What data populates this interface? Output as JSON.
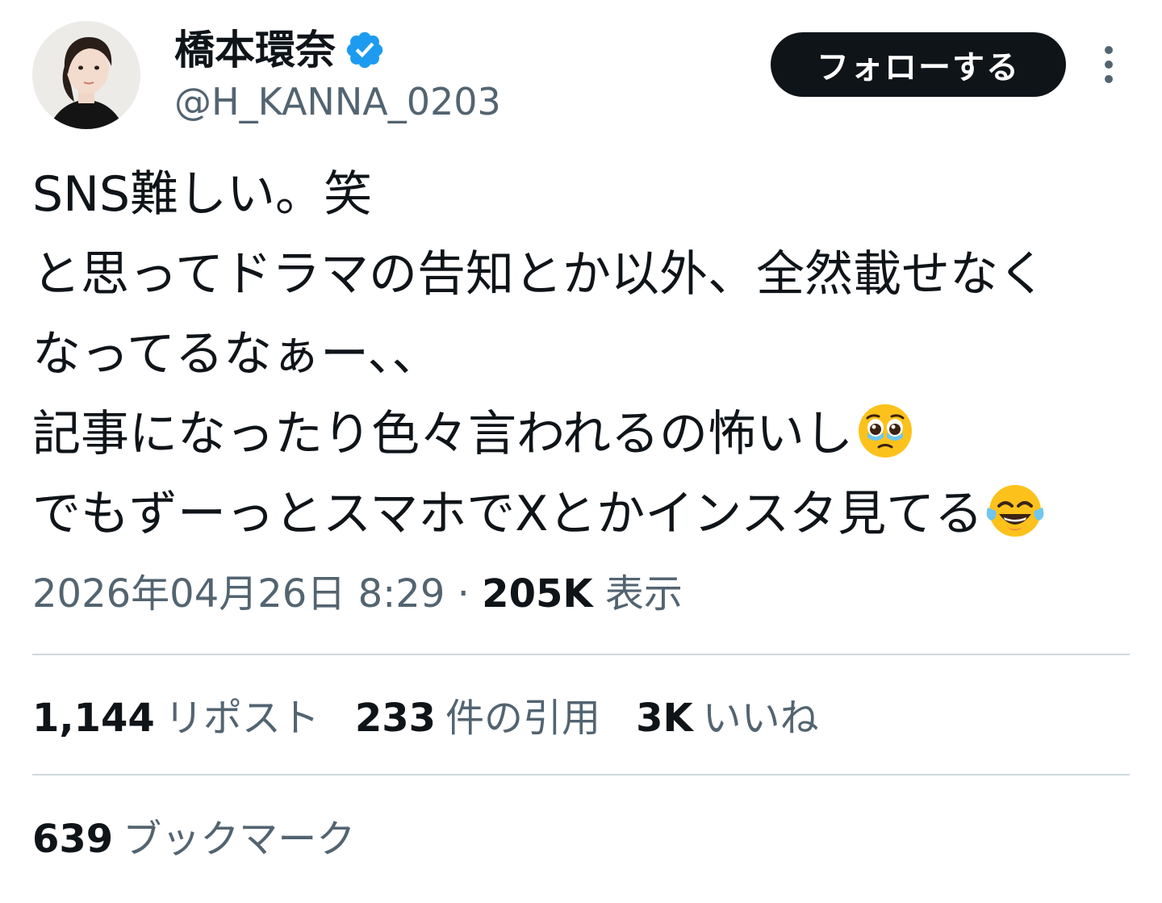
{
  "author": {
    "display_name": "橋本環奈",
    "handle": "@H_KANNA_0203",
    "verified": true
  },
  "follow_button": {
    "label": "フォローする"
  },
  "tweet": {
    "lines": [
      "SNS難しい。笑",
      "と思ってドラマの告知とか以外、全然載せなく",
      "なってるなぁー､､",
      "記事になったり色々言われるの怖いし",
      "でもずーっとスマホでXとかインスタ見てる"
    ]
  },
  "meta": {
    "timestamp": "2026年04月26日 8:29",
    "separator": "·",
    "views_count": "205K",
    "views_label": "表示"
  },
  "stats": {
    "reposts": {
      "count": "1,144",
      "label": "リポスト"
    },
    "quotes": {
      "count": "233",
      "label": "件の引用"
    },
    "likes": {
      "count": "3K",
      "label": "いいね"
    }
  },
  "bookmarks": {
    "count": "639",
    "label": "ブックマーク"
  },
  "colors": {
    "text_primary": "#0f1419",
    "text_secondary": "#536471",
    "verified_badge": "#1d9bf0",
    "divider": "#cfd9de",
    "follow_button_bg": "#0f1419"
  },
  "icons": {
    "verified": "verified-badge-icon",
    "more": "more-vertical-icon",
    "emoji_1": "pleading-face-tears-emoji",
    "emoji_2": "tears-of-joy-emoji"
  }
}
